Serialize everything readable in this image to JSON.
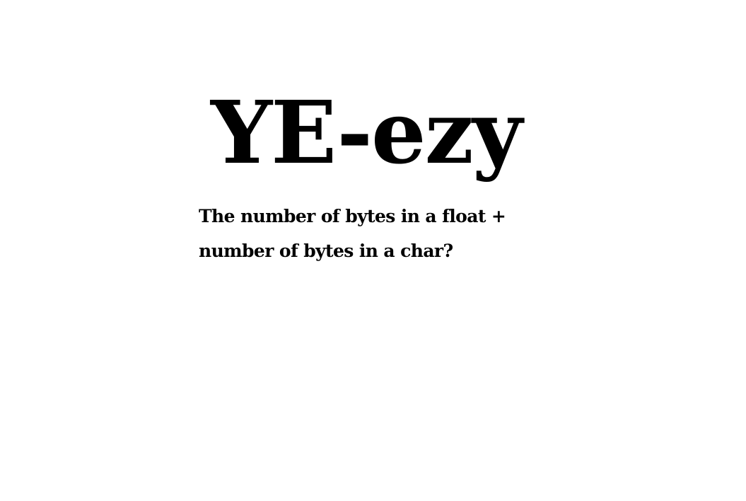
{
  "slide": {
    "title": "YE-ezy",
    "question_lines": [
      "The number of bytes in a float +",
      "number of bytes in a char?"
    ]
  },
  "colors": {
    "background": "#ffffff",
    "text": "#000000"
  }
}
